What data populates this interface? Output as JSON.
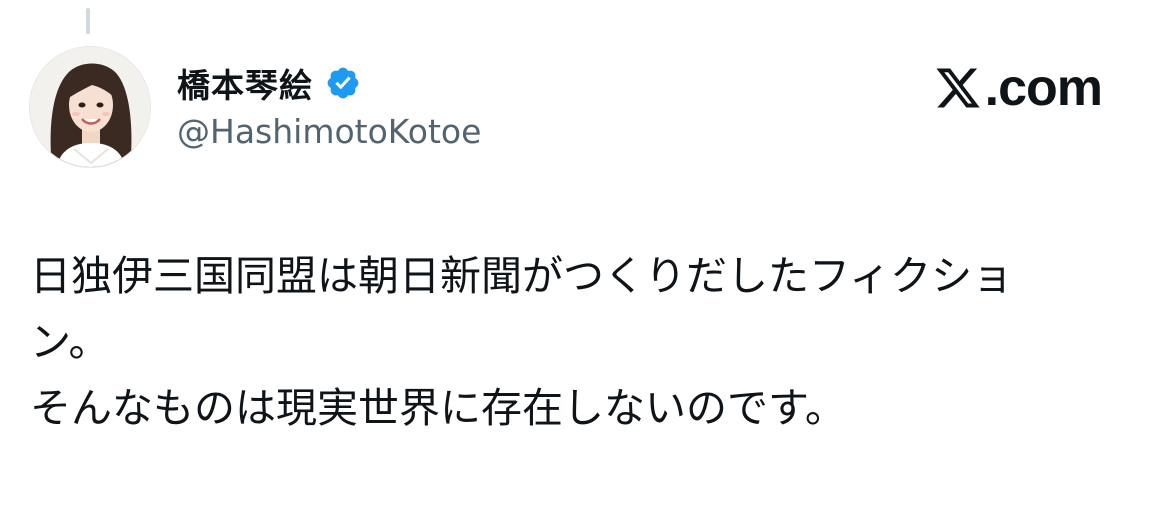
{
  "author": {
    "display_name": "橋本琴絵",
    "handle": "@HashimotoKotoe",
    "verified": true,
    "avatar_icon": "profile-photo"
  },
  "brand": {
    "logo_icon": "x-logo-icon",
    "text": ".com"
  },
  "tweet": {
    "lines": [
      "日独伊三国同盟は朝日新聞がつくりだしたフィクショ",
      "ン。",
      "そんなものは現実世界に存在しないのです。"
    ]
  },
  "colors": {
    "text": "#0f1419",
    "secondary": "#536471",
    "verified": "#1d9bf0",
    "thread_line": "#cfd9de",
    "background": "#ffffff"
  }
}
